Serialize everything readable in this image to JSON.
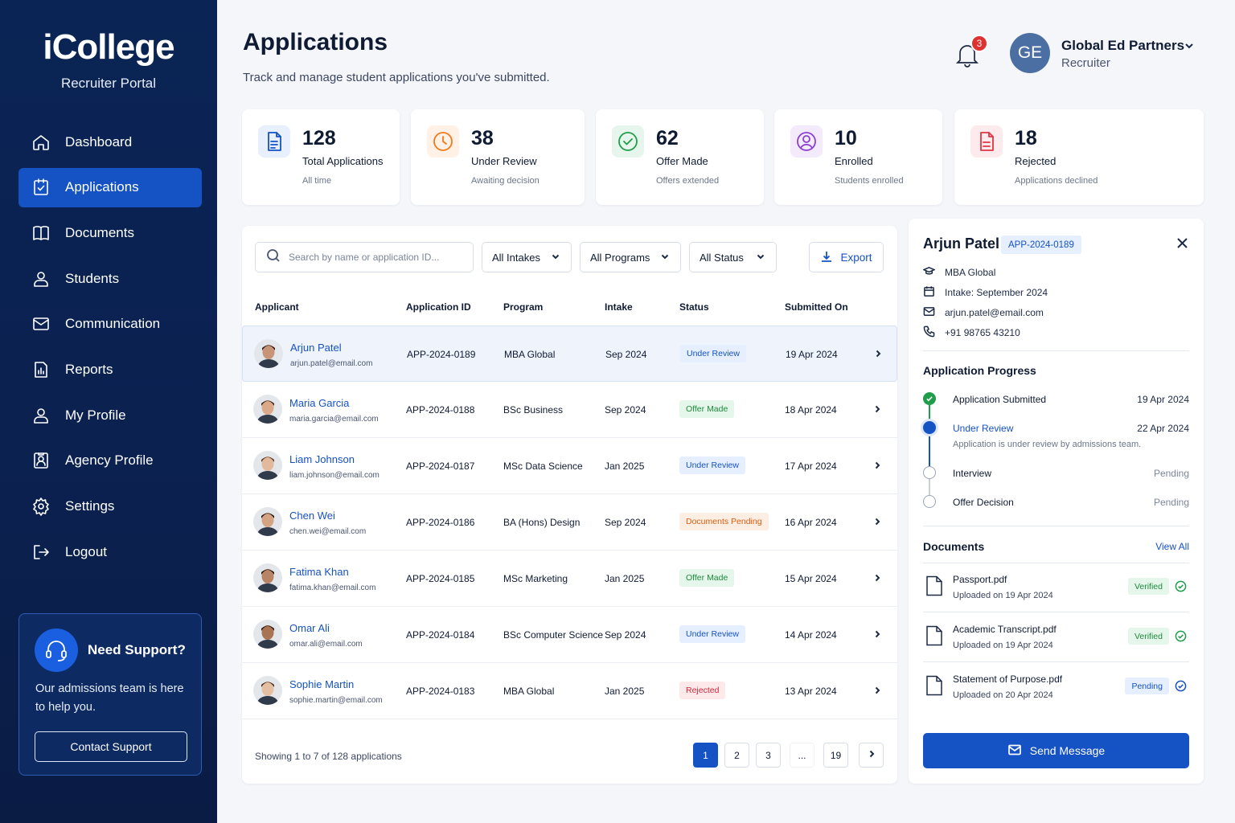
{
  "brand": {
    "logo": "iCollege",
    "subtitle": "Recruiter Portal"
  },
  "nav": [
    {
      "label": "Dashboard",
      "icon": "home-icon"
    },
    {
      "label": "Applications",
      "icon": "clipboard-check-icon",
      "active": true
    },
    {
      "label": "Documents",
      "icon": "book-icon"
    },
    {
      "label": "Students",
      "icon": "user-icon"
    },
    {
      "label": "Communication",
      "icon": "mail-icon"
    },
    {
      "label": "Reports",
      "icon": "bar-chart-icon"
    },
    {
      "label": "My Profile",
      "icon": "user-icon"
    },
    {
      "label": "Agency Profile",
      "icon": "id-card-icon"
    },
    {
      "label": "Settings",
      "icon": "gear-icon"
    },
    {
      "label": "Logout",
      "icon": "logout-icon"
    }
  ],
  "support": {
    "title": "Need Support?",
    "text": "Our admissions team is here to help you.",
    "button": "Contact Support"
  },
  "header": {
    "title": "Applications",
    "subtitle": "Track and manage student applications you've submitted.",
    "notifications": "3",
    "user_initials": "GE",
    "user_name": "Global Ed Partners",
    "user_role": "Recruiter"
  },
  "stats": [
    {
      "value": "128",
      "label": "Total Applications",
      "sub": "All time",
      "color": "#1552c4",
      "bg": "#e8f0ff",
      "icon": "document-icon"
    },
    {
      "value": "38",
      "label": "Under Review",
      "sub": "Awaiting decision",
      "color": "#f07a1a",
      "bg": "#fff1e5",
      "icon": "clock-icon"
    },
    {
      "value": "62",
      "label": "Offer Made",
      "sub": "Offers extended",
      "color": "#1f9d4a",
      "bg": "#e6f6ec",
      "icon": "check-circle-icon"
    },
    {
      "value": "10",
      "label": "Enrolled",
      "sub": "Students enrolled",
      "color": "#8a3fd1",
      "bg": "#f3eafc",
      "icon": "user-circle-icon"
    },
    {
      "value": "18",
      "label": "Rejected",
      "sub": "Applications declined",
      "color": "#e03545",
      "bg": "#fdeaec",
      "icon": "document-x-icon"
    }
  ],
  "toolbar": {
    "search_placeholder": "Search by name or application ID...",
    "intakes": "All Intakes",
    "programs": "All Programs",
    "status": "All Status",
    "export": "Export"
  },
  "table": {
    "headers": [
      "Applicant",
      "Application ID",
      "Program",
      "Intake",
      "Status",
      "Submitted On"
    ],
    "rows": [
      {
        "name": "Arjun Patel",
        "email": "arjun.patel@email.com",
        "id": "APP-2024-0189",
        "program": "MBA Global",
        "intake": "Sep 2024",
        "status": "Under Review",
        "status_kind": "review",
        "submitted": "19 Apr 2024",
        "selected": true
      },
      {
        "name": "Maria Garcia",
        "email": "maria.garcia@email.com",
        "id": "APP-2024-0188",
        "program": "BSc Business",
        "intake": "Sep 2024",
        "status": "Offer Made",
        "status_kind": "offer",
        "submitted": "18 Apr 2024"
      },
      {
        "name": "Liam Johnson",
        "email": "liam.johnson@email.com",
        "id": "APP-2024-0187",
        "program": "MSc Data Science",
        "intake": "Jan 2025",
        "status": "Under Review",
        "status_kind": "review",
        "submitted": "17 Apr 2024"
      },
      {
        "name": "Chen Wei",
        "email": "chen.wei@email.com",
        "id": "APP-2024-0186",
        "program": "BA (Hons) Design",
        "intake": "Sep 2024",
        "status": "Documents Pending",
        "status_kind": "docs",
        "submitted": "16 Apr 2024"
      },
      {
        "name": "Fatima Khan",
        "email": "fatima.khan@email.com",
        "id": "APP-2024-0185",
        "program": "MSc Marketing",
        "intake": "Jan 2025",
        "status": "Offer Made",
        "status_kind": "offer",
        "submitted": "15 Apr 2024"
      },
      {
        "name": "Omar Ali",
        "email": "omar.ali@email.com",
        "id": "APP-2024-0184",
        "program": "BSc Computer Science",
        "intake": "Sep 2024",
        "status": "Under Review",
        "status_kind": "review",
        "submitted": "14 Apr 2024"
      },
      {
        "name": "Sophie Martin",
        "email": "sophie.martin@email.com",
        "id": "APP-2024-0183",
        "program": "MBA Global",
        "intake": "Jan 2025",
        "status": "Rejected",
        "status_kind": "rej",
        "submitted": "13 Apr 2024"
      }
    ]
  },
  "pagination": {
    "showing": "Showing 1 to 7 of 128 applications",
    "pages": [
      "1",
      "2",
      "3",
      "...",
      "19"
    ],
    "current": "1"
  },
  "detail": {
    "name": "Arjun Patel",
    "app_id": "APP-2024-0189",
    "program": "MBA Global",
    "intake": "Intake: September 2024",
    "email": "arjun.patel@email.com",
    "phone": "+91 98765 43210",
    "progress_title": "Application Progress",
    "progress": [
      {
        "label": "Application Submitted",
        "date": "19 Apr 2024",
        "state": "done"
      },
      {
        "label": "Under Review",
        "date": "22 Apr 2024",
        "state": "current",
        "note": "Application is under review by admissions team."
      },
      {
        "label": "Interview",
        "date": "Pending",
        "state": "pending"
      },
      {
        "label": "Offer Decision",
        "date": "Pending",
        "state": "pending"
      }
    ],
    "documents_title": "Documents",
    "view_all": "View All",
    "documents": [
      {
        "name": "Passport.pdf",
        "uploaded": "Uploaded on 19 Apr 2024",
        "status": "Verified",
        "kind": "verified"
      },
      {
        "name": "Academic Transcript.pdf",
        "uploaded": "Uploaded on 19 Apr 2024",
        "status": "Verified",
        "kind": "verified"
      },
      {
        "name": "Statement of Purpose.pdf",
        "uploaded": "Uploaded on 20 Apr 2024",
        "status": "Pending",
        "kind": "pending"
      }
    ],
    "send_button": "Send Message"
  }
}
